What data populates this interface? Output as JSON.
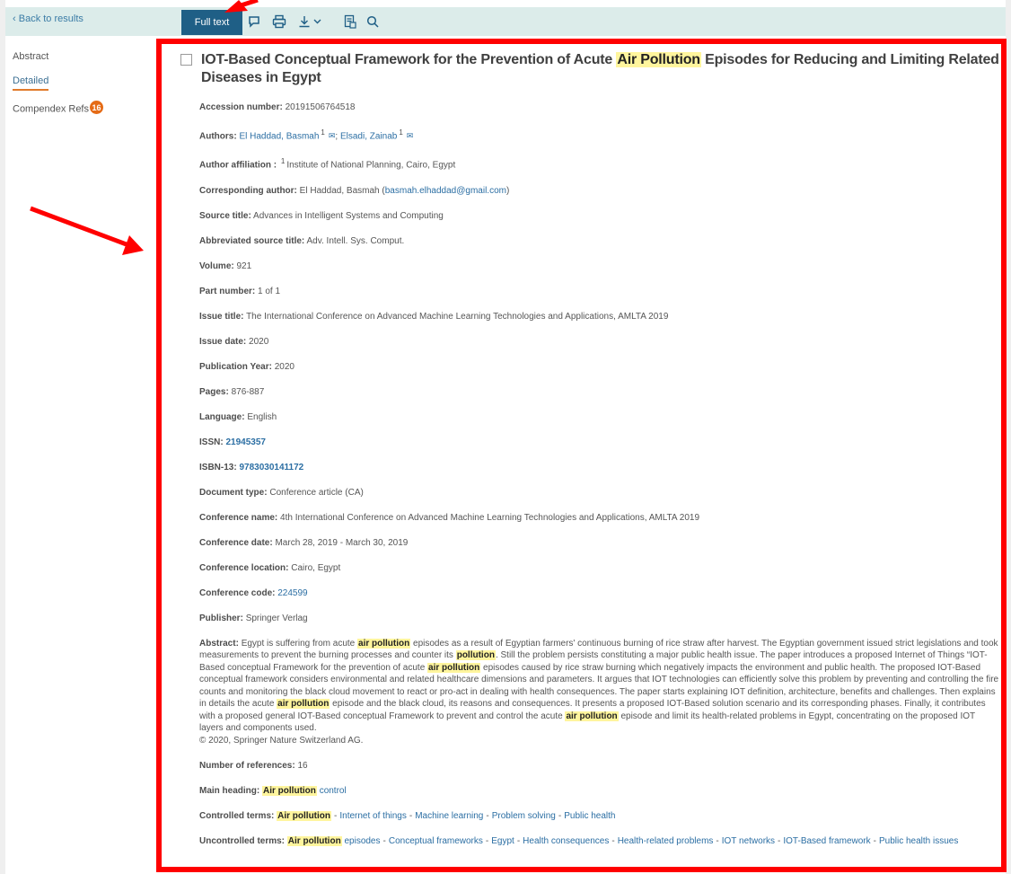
{
  "toolbar": {
    "back_label": "Back to results",
    "fulltext_label": "Full text"
  },
  "icons": {
    "comment": "comment-icon",
    "print": "print-icon",
    "download": "download-icon",
    "export": "export-icon",
    "search": "search-icon"
  },
  "side_nav": {
    "items": [
      {
        "label": "Abstract"
      },
      {
        "label": "Detailed"
      },
      {
        "label": "Compendex Refs",
        "badge": "16"
      }
    ]
  },
  "record": {
    "title_pre": "IOT-Based Conceptual Framework for the Prevention of Acute ",
    "title_highlight": "Air Pollution",
    "title_post": " Episodes for Reducing and Limiting Related Diseases in Egypt",
    "accession_label": "Accession number:",
    "accession": "20191506764518",
    "authors_label": "Authors:",
    "author1": "El Haddad, Basmah",
    "author2": "Elsadi, Zainab",
    "aff_sup": "1",
    "affiliation_label": "Author affiliation :",
    "affiliation": "Institute of National Planning, Cairo, Egypt",
    "corresponding_label": "Corresponding author:",
    "corresponding_name": "El Haddad, Basmah (",
    "corresponding_email": "basmah.elhaddad@gmail.com",
    "corresponding_close": ")",
    "source_label": "Source title:",
    "source": "Advances in Intelligent Systems and Computing",
    "abbrev_label": "Abbreviated source title:",
    "abbrev": "Adv. Intell. Sys. Comput.",
    "volume_label": "Volume:",
    "volume": "921",
    "part_label": "Part number:",
    "part": "1 of 1",
    "issue_title_label": "Issue title:",
    "issue_title": "The International Conference on Advanced Machine Learning Technologies and Applications, AMLTA 2019",
    "issue_date_label": "Issue date:",
    "issue_date": "2020",
    "pub_year_label": "Publication Year:",
    "pub_year": "2020",
    "pages_label": "Pages:",
    "pages": "876-887",
    "language_label": "Language:",
    "language": "English",
    "issn_label": "ISSN:",
    "issn": "21945357",
    "isbn_label": "ISBN-13:",
    "isbn": "9783030141172",
    "doctype_label": "Document type:",
    "doctype": "Conference article (CA)",
    "conf_name_label": "Conference name:",
    "conf_name": "4th International Conference on Advanced Machine Learning Technologies and Applications, AMLTA 2019",
    "conf_date_label": "Conference date:",
    "conf_date": "March 28, 2019 - March 30, 2019",
    "conf_loc_label": "Conference location:",
    "conf_loc": "Cairo, Egypt",
    "conf_code_label": "Conference code:",
    "conf_code": "224599",
    "publisher_label": "Publisher:",
    "publisher": "Springer Verlag",
    "abstract_label": "Abstract:",
    "abstract_1": "Egypt is suffering from acute ",
    "abstract_hl_1": "air pollution",
    "abstract_2": " episodes as a result of Egyptian farmers' continuous burning of rice straw after harvest. The Egyptian government issued strict legislations and took measurements to prevent the burning processes and counter its ",
    "abstract_hl_2": "pollution",
    "abstract_3": ". Still the problem persists constituting a major public health issue. The paper introduces a proposed Internet of Things “IOT-Based conceptual Framework for the prevention of acute ",
    "abstract_hl_3": "air pollution",
    "abstract_4": " episodes caused by rice straw burning which negatively impacts the environment and public health. The proposed IOT-Based conceptual framework considers environmental and related healthcare dimensions and parameters. It argues that IOT technologies can efficiently solve this problem by preventing and controlling the fire counts and monitoring the black cloud movement to react or pro-act in dealing with health consequences. The paper starts explaining IOT definition, architecture, benefits and challenges. Then explains in details the acute ",
    "abstract_hl_4": "air pollution",
    "abstract_5": " episode and the black cloud, its reasons and consequences. It presents a proposed IOT-Based solution scenario and its corresponding phases. Finally, it contributes with a proposed general IOT-Based conceptual Framework to prevent and control the acute ",
    "abstract_hl_5": "air pollution",
    "abstract_6": " episode and limit its health-related problems in Egypt, concentrating on the proposed IOT layers and components used.",
    "copyright": "© 2020, Springer Nature Switzerland AG.",
    "numrefs_label": "Number of references:",
    "numrefs": "16",
    "main_heading_label": "Main heading:",
    "main_heading_hl": "Air pollution",
    "main_heading_rest": "control",
    "controlled_label": "Controlled terms:",
    "controlled_hl": "Air pollution",
    "controlled_terms": [
      "Internet of things",
      "Machine learning",
      "Problem solving",
      "Public health"
    ],
    "uncontrolled_label": "Uncontrolled terms:",
    "uncontrolled_hl": "Air pollution",
    "uncontrolled_first_rest": "episodes",
    "uncontrolled_terms": [
      "Conceptual frameworks",
      "Egypt",
      "Health consequences",
      "Health-related problems",
      "IOT networks",
      "IOT-Based framework",
      "Public health issues"
    ],
    "separator": "-"
  },
  "colors": {
    "annotation": "#ff0000",
    "toolbar_bg": "#dcecea",
    "button_bg": "#1f5f86",
    "highlight": "#fff59d",
    "badge": "#e56b16"
  }
}
